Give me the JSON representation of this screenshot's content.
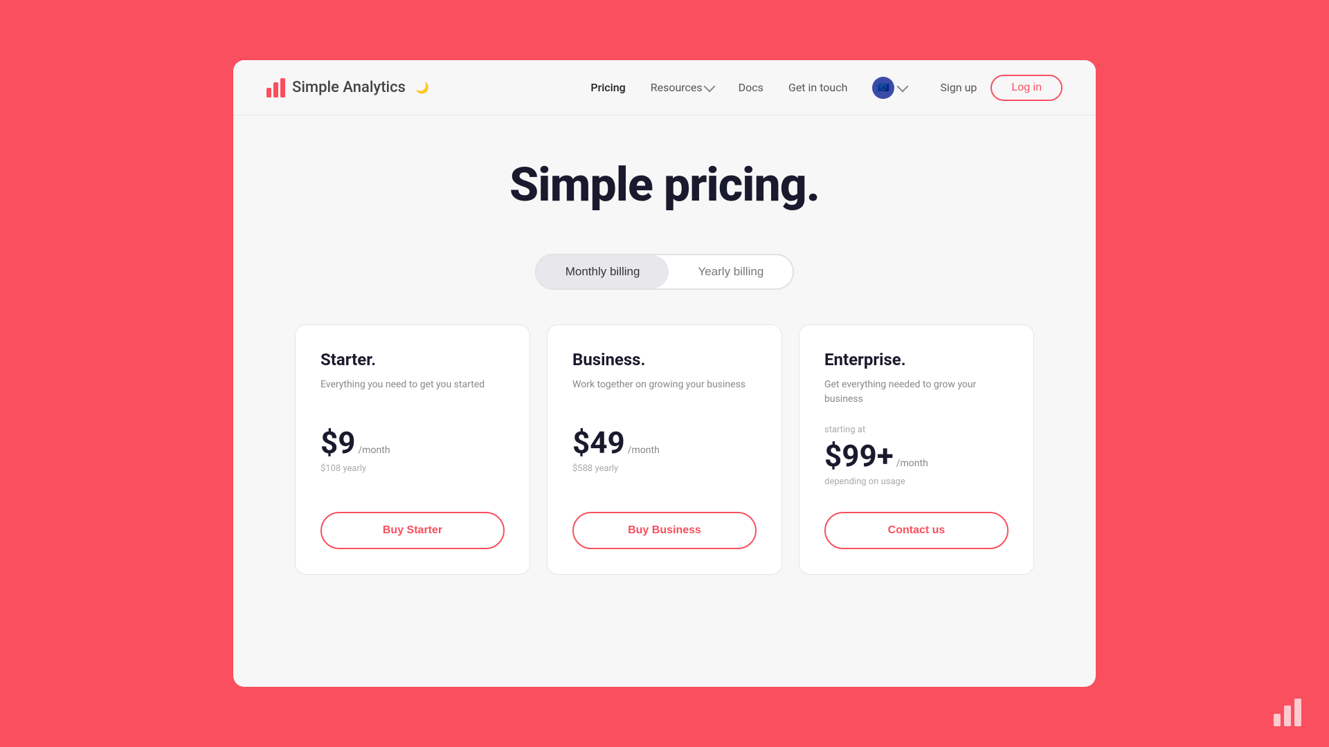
{
  "app": {
    "name": "Simple Analytics",
    "moon_icon": "🌙"
  },
  "navbar": {
    "logo_text": "Simple Analytics",
    "links": [
      {
        "id": "pricing",
        "label": "Pricing",
        "has_dropdown": false,
        "active": true
      },
      {
        "id": "resources",
        "label": "Resources",
        "has_dropdown": true,
        "active": false
      },
      {
        "id": "docs",
        "label": "Docs",
        "has_dropdown": false,
        "active": false
      },
      {
        "id": "get-in-touch",
        "label": "Get in touch",
        "has_dropdown": false,
        "active": false
      }
    ],
    "eu_flag": "🇪🇺",
    "sign_up": "Sign up",
    "login": "Log in"
  },
  "hero": {
    "title": "Simple pricing."
  },
  "billing_toggle": {
    "monthly": "Monthly billing",
    "yearly": "Yearly billing",
    "active": "monthly"
  },
  "plans": [
    {
      "id": "starter",
      "name": "Starter.",
      "description": "Everything you need to get you started",
      "starting_at": null,
      "price": "$9",
      "period": "/month",
      "yearly_price": "$108 yearly",
      "usage_note": null,
      "cta": "Buy Starter"
    },
    {
      "id": "business",
      "name": "Business.",
      "description": "Work together on growing your business",
      "starting_at": null,
      "price": "$49",
      "period": "/month",
      "yearly_price": "$588 yearly",
      "usage_note": null,
      "cta": "Buy Business"
    },
    {
      "id": "enterprise",
      "name": "Enterprise.",
      "description": "Get everything needed to grow your business",
      "starting_at": "starting at",
      "price": "$99+",
      "period": "/month",
      "yearly_price": null,
      "usage_note": "depending on usage",
      "cta": "Contact us"
    }
  ]
}
